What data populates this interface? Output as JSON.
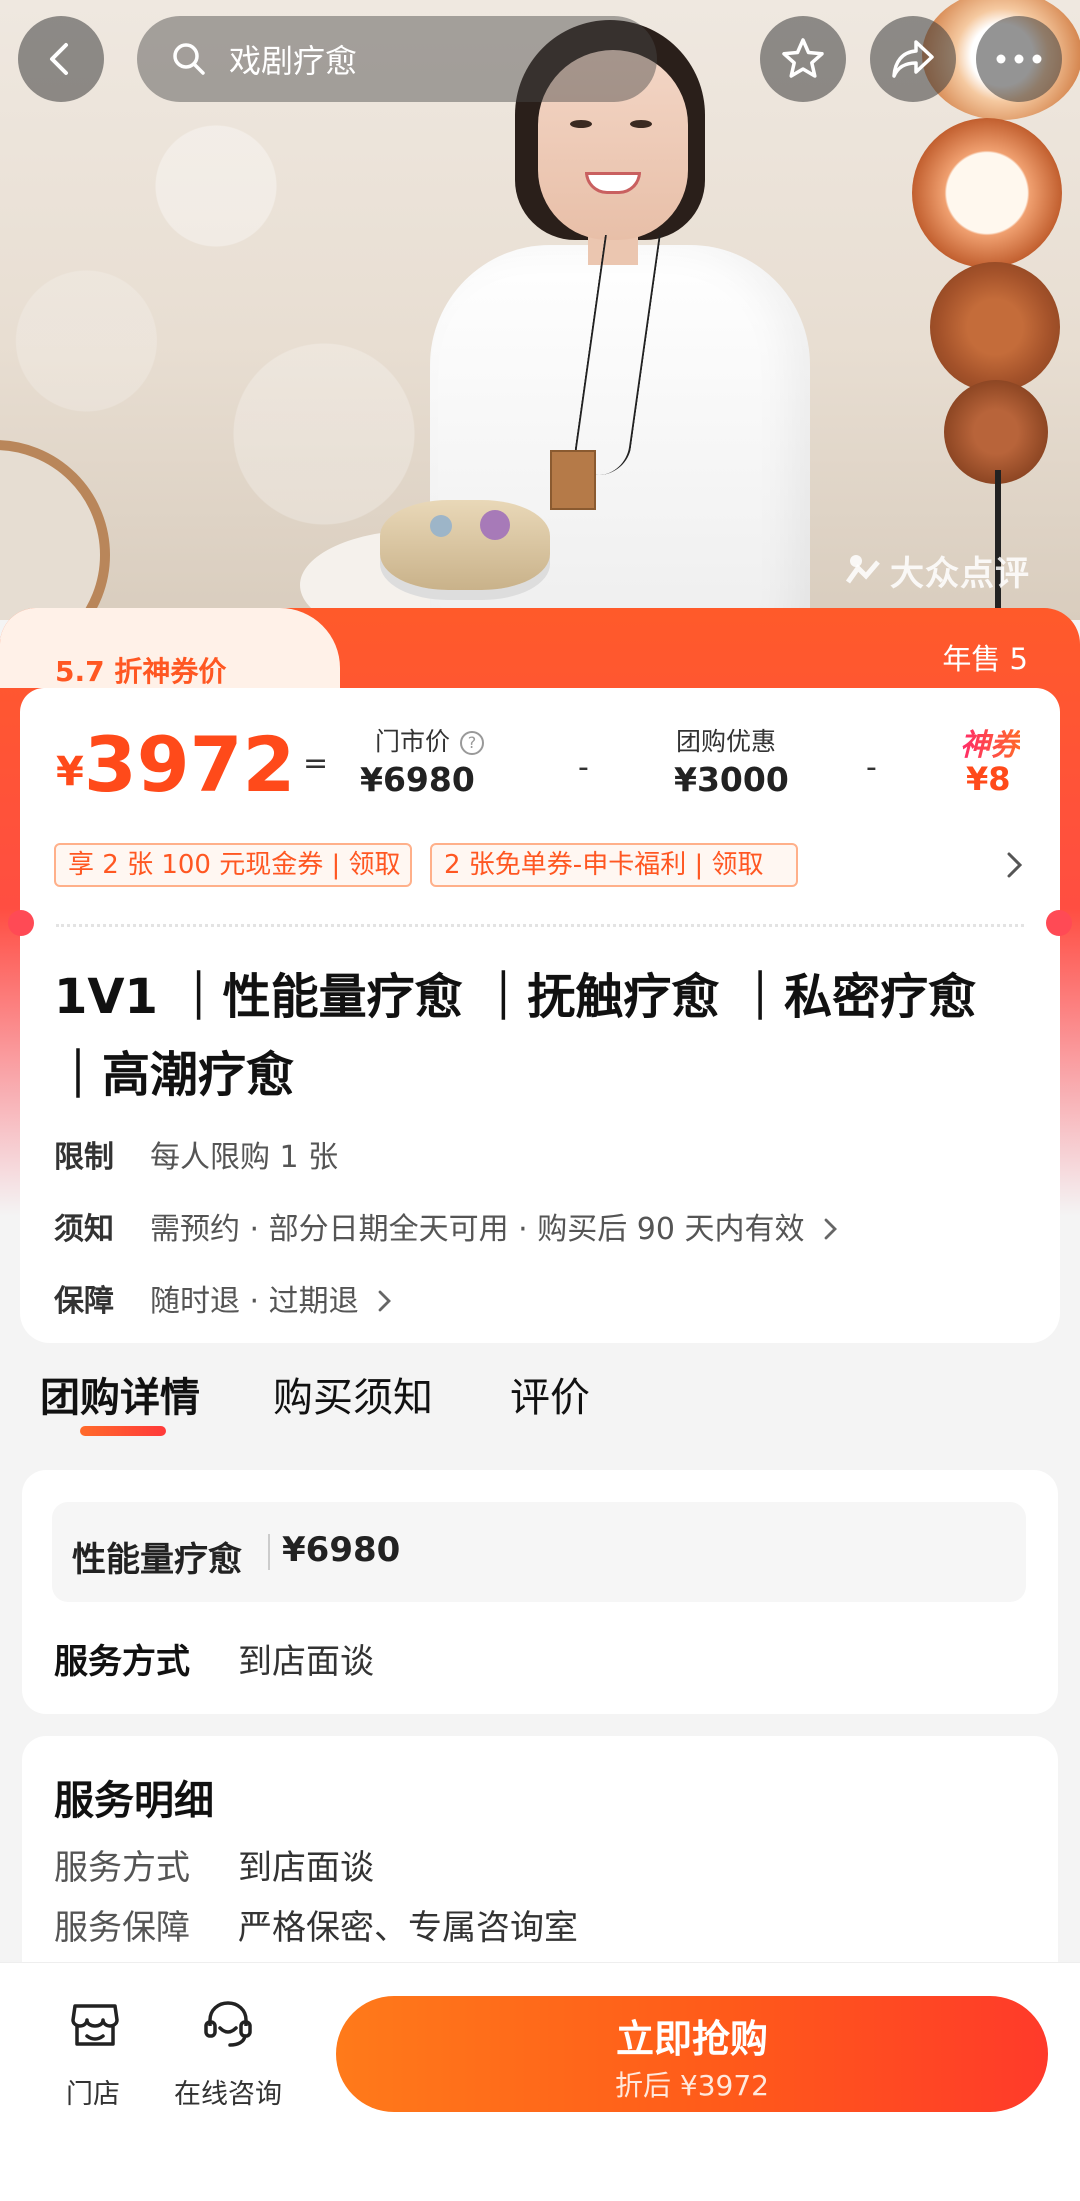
{
  "nav": {
    "search_text": "戏剧疗愈"
  },
  "hero": {
    "watermark": "大众点评"
  },
  "price": {
    "tag": "5.7 折神券价",
    "annual_sales": "年售 5",
    "currency": "¥",
    "final_price": "3972",
    "equals": "=",
    "store_price_label": "门市价",
    "store_price_help": "?",
    "store_price": "¥6980",
    "minus": "-",
    "group_discount_label": "团购优惠",
    "group_discount": "¥3000",
    "shen_label": "神券",
    "shen_value": "¥8"
  },
  "coupons": [
    "享 2 张 100 元现金券 | 领取",
    "2 张免单券-申卡福利 | 领取"
  ],
  "product": {
    "title": "1V1 ｜性能量疗愈 ｜抚触疗愈 ｜私密疗愈 ｜高潮疗愈",
    "rows": [
      {
        "key": "限制",
        "value": "每人限购 1 张"
      },
      {
        "key": "须知",
        "value": "需预约 · 部分日期全天可用 · 购买后 90 天内有效"
      },
      {
        "key": "保障",
        "value": "随时退 · 过期退"
      }
    ]
  },
  "tabs": [
    {
      "label": "团购详情",
      "active": true
    },
    {
      "label": "购买须知",
      "active": false
    },
    {
      "label": "评价",
      "active": false
    }
  ],
  "package": {
    "name": "性能量疗愈",
    "price": "¥6980",
    "service_label": "服务方式",
    "service_value": "到店面谈"
  },
  "details": {
    "title": "服务明细",
    "rows": [
      {
        "key": "服务方式",
        "value": "到店面谈"
      },
      {
        "key": "服务保障",
        "value": "严格保密、专属咨询室"
      }
    ]
  },
  "bottom": {
    "store_label": "门店",
    "consult_label": "在线咨询",
    "buy_label": "立即抢购",
    "buy_sub": "折后 ¥3972"
  },
  "colors": {
    "accent": "#ff5722",
    "brand_gradient_start": "#ff7a1a",
    "brand_gradient_end": "#ff3a2a"
  }
}
